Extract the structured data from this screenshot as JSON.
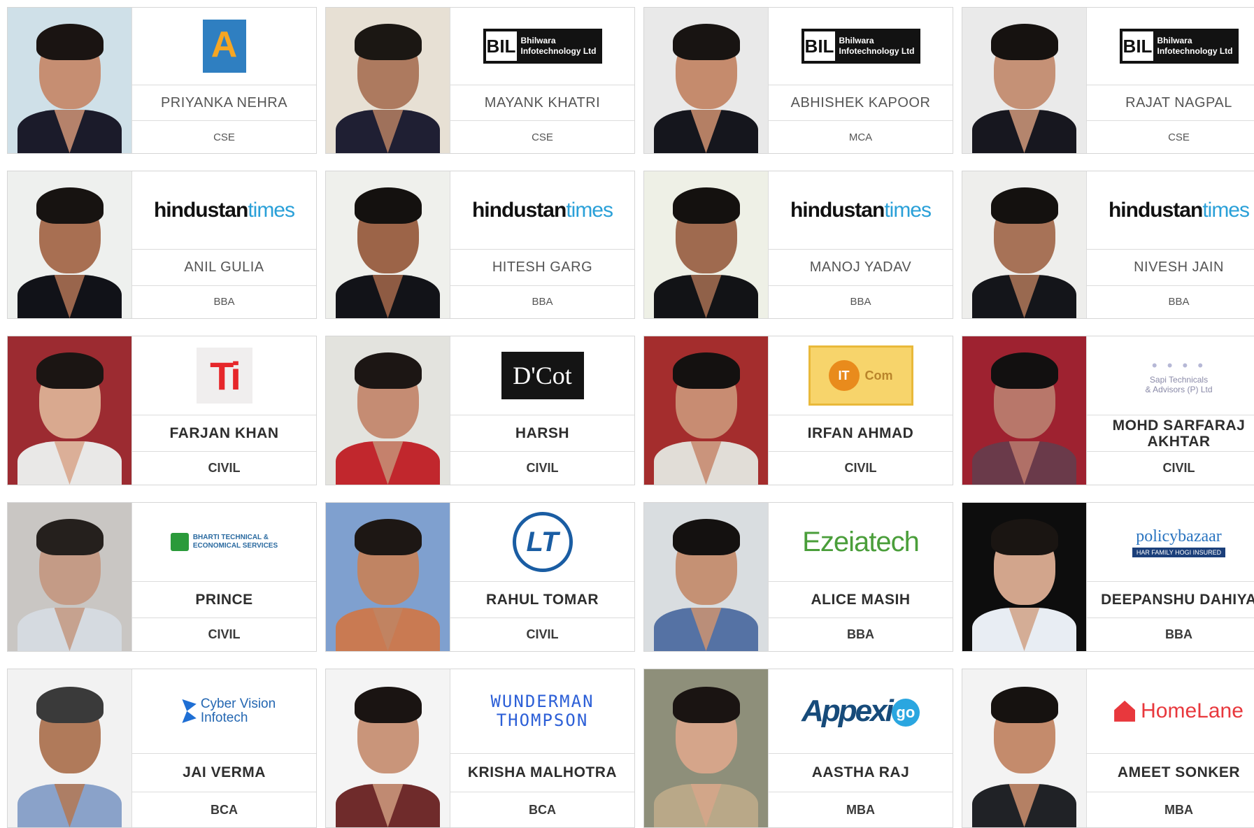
{
  "cards": [
    {
      "name": "PRIYANKA NEHRA",
      "dept": "CSE",
      "logo": "astar",
      "photo_bg": "#cfe0e8",
      "shirt": "#1b1b2a",
      "skin": "#c68e72",
      "hair": "#1a1412"
    },
    {
      "name": "MAYANK KHATRI",
      "dept": "CSE",
      "logo": "bil",
      "photo_bg": "#e7e0d4",
      "shirt": "#1f1f33",
      "skin": "#ad7a5f",
      "hair": "#1b1713"
    },
    {
      "name": "ABHISHEK KAPOOR",
      "dept": "MCA",
      "logo": "bil",
      "photo_bg": "#e9e9e9",
      "shirt": "#15161d",
      "skin": "#c58b6d",
      "hair": "#181412"
    },
    {
      "name": "RAJAT NAGPAL",
      "dept": "CSE",
      "logo": "bil",
      "photo_bg": "#eaeaea",
      "shirt": "#17171f",
      "skin": "#c59176",
      "hair": "#161210"
    },
    {
      "name": "ANIL GULIA",
      "dept": "BBA",
      "logo": "ht",
      "photo_bg": "#eef0ee",
      "shirt": "#111218",
      "skin": "#a86f52",
      "hair": "#171311"
    },
    {
      "name": "HITESH GARG",
      "dept": "BBA",
      "logo": "ht",
      "photo_bg": "#eff0ec",
      "shirt": "#121318",
      "skin": "#9c6448",
      "hair": "#14110f"
    },
    {
      "name": "MANOJ YADAV",
      "dept": "BBA",
      "logo": "ht",
      "photo_bg": "#eef0e6",
      "shirt": "#121316",
      "skin": "#9f6a4f",
      "hair": "#14110f"
    },
    {
      "name": "NIVESH JAIN",
      "dept": "BBA",
      "logo": "ht",
      "photo_bg": "#eeeeec",
      "shirt": "#14151a",
      "skin": "#a77257",
      "hair": "#14110f"
    },
    {
      "name": "FARJAN KHAN",
      "dept": "CIVIL",
      "logo": "ti",
      "photo_bg": "#9c2b31",
      "shirt": "#e9e8e7",
      "skin": "#d9a98f",
      "hair": "#1b1513"
    },
    {
      "name": "HARSH",
      "dept": "CIVIL",
      "logo": "dcot",
      "photo_bg": "#e3e3de",
      "shirt": "#c1272d",
      "skin": "#c58c73",
      "hair": "#1c1614"
    },
    {
      "name": "IRFAN AHMAD",
      "dept": "CIVIL",
      "logo": "itcom",
      "photo_bg": "#a42d2d",
      "shirt": "#e1ddd7",
      "skin": "#c88c72",
      "hair": "#141110"
    },
    {
      "name": "MOHD SARFARAJ AKHTAR",
      "dept": "CIVIL",
      "logo": "sapi",
      "photo_bg": "#9e2230",
      "shirt": "#6a3a4a",
      "skin": "#b8776a",
      "hair": "#121010"
    },
    {
      "name": "PRINCE",
      "dept": "CIVIL",
      "logo": "bharti",
      "photo_bg": "#c9c6c3",
      "shirt": "#d5dae0",
      "skin": "#c49b86",
      "hair": "#25201d"
    },
    {
      "name": "RAHUL TOMAR",
      "dept": "CIVIL",
      "logo": "lt",
      "photo_bg": "#7fa0cf",
      "shirt": "#c97a52",
      "skin": "#c08463",
      "hair": "#1d1714"
    },
    {
      "name": "ALICE MASIH",
      "dept": "BBA",
      "logo": "ezeia",
      "photo_bg": "#d9dde0",
      "shirt": "#5572a4",
      "skin": "#c59174",
      "hair": "#141110"
    },
    {
      "name": "DEEPANSHU DAHIYA",
      "dept": "BBA",
      "logo": "pb",
      "photo_bg": "#0d0d0d",
      "shirt": "#e8edf3",
      "skin": "#d2a58c",
      "hair": "#1a1512"
    },
    {
      "name": "JAI VERMA",
      "dept": "BCA",
      "logo": "cv",
      "photo_bg": "#f2f2f2",
      "shirt": "#8aa2c9",
      "skin": "#b07a5a",
      "hair": "#3a3a3a"
    },
    {
      "name": "KRISHA MALHOTRA",
      "dept": "BCA",
      "logo": "wt",
      "photo_bg": "#f4f4f4",
      "shirt": "#6f2b2b",
      "skin": "#c9957a",
      "hair": "#1a1412"
    },
    {
      "name": "AASTHA RAJ",
      "dept": "MBA",
      "logo": "appexigo",
      "photo_bg": "#8e8f7a",
      "shirt": "#b9a888",
      "skin": "#d5a58a",
      "hair": "#1a1412"
    },
    {
      "name": "AMEET SONKER",
      "dept": "MBA",
      "logo": "homelane",
      "photo_bg": "#f3f3f3",
      "shirt": "#202226",
      "skin": "#c48b6c",
      "hair": "#161210"
    }
  ],
  "logos": {
    "bil": {
      "mark": "BIL",
      "line1": "Bhilwara",
      "line2": "Infotechnology Ltd"
    },
    "ht": {
      "part1": "hindustan",
      "part2": "times"
    },
    "ti": {
      "text": "Ti"
    },
    "dcot": {
      "text": "D'Cot"
    },
    "itcom": {
      "mark": "IT",
      "text": "Com"
    },
    "sapi": {
      "line1": "Sapi Technicals",
      "line2": "& Advisors (P) Ltd"
    },
    "bharti": {
      "line1": "BHARTI TECHNICAL &",
      "line2": "ECONOMICAL SERVICES"
    },
    "lt": {
      "text": "LT"
    },
    "ezeia": {
      "text": "Ezeiatech"
    },
    "pb": {
      "top": "policybazaar",
      "bar": "HAR FAMILY HOGI INSURED"
    },
    "cv": {
      "line1": "Cyber Vision",
      "line2": "Infotech"
    },
    "wt": {
      "line1": "WUNDERMAN",
      "line2": "THOMPSON"
    },
    "appexigo": {
      "text": "Appexi",
      "go": "go"
    },
    "homelane": {
      "text": "HomeLane"
    }
  }
}
